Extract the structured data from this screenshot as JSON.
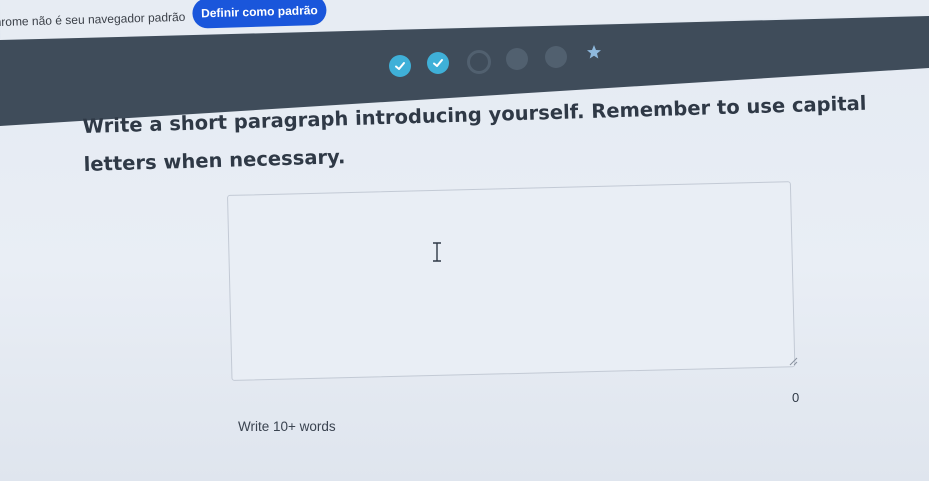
{
  "banner": {
    "message": "hrome não é seu navegador padrão",
    "button_label": "Definir como padrão"
  },
  "progress": {
    "steps": [
      {
        "state": "done",
        "icon": "check-icon"
      },
      {
        "state": "done",
        "icon": "check-icon"
      },
      {
        "state": "current",
        "icon": ""
      },
      {
        "state": "todo",
        "icon": ""
      },
      {
        "state": "todo",
        "icon": ""
      },
      {
        "state": "final",
        "icon": "star-icon"
      }
    ],
    "colors": {
      "band": "#3f4c5a",
      "done": "#3fb0d8",
      "todo": "#51606f",
      "star": "#8fb9dd"
    }
  },
  "question": {
    "text": "Write a short paragraph introducing yourself. Remember to use capital letters when necessary."
  },
  "answer": {
    "value": "",
    "word_count": "0"
  },
  "hint": {
    "text": "Write 10+ words"
  },
  "colors": {
    "accent": "#1a56db"
  }
}
